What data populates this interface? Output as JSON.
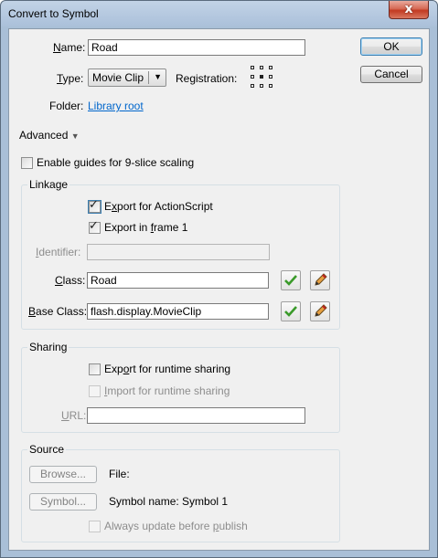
{
  "window": {
    "title": "Convert to Symbol",
    "close_glyph": "x"
  },
  "form": {
    "name_label_u": "N",
    "name_label_rest": "ame:",
    "name_value": "Road",
    "type_label_u": "T",
    "type_label_rest": "ype:",
    "type_value": "Movie Clip",
    "registration_label": "Registration:",
    "folder_label": "Folder:",
    "folder_value": "Library root",
    "advanced_label": "Advanced"
  },
  "buttons": {
    "ok": "OK",
    "cancel": "Cancel"
  },
  "nine_slice": {
    "pre": "Enable ",
    "u": "g",
    "post": "uides for 9-slice scaling",
    "checked": false
  },
  "linkage": {
    "title": "Linkage",
    "export_actionscript": {
      "pre": "E",
      "u": "x",
      "post": "port for ActionScript",
      "checked": true
    },
    "export_frame1": {
      "pre": "Export in ",
      "u": "f",
      "post": "rame 1",
      "checked": true
    },
    "identifier_label_u": "I",
    "identifier_label_rest": "dentifier:",
    "identifier_value": "",
    "class_label_u": "C",
    "class_label_rest": "lass:",
    "class_value": "Road",
    "base_class_label_u": "B",
    "base_class_label_rest": "ase Class:",
    "base_class_value": "flash.display.MovieClip"
  },
  "sharing": {
    "title": "Sharing",
    "export_runtime": {
      "pre": "Exp",
      "u": "o",
      "post": "rt for runtime sharing",
      "checked": false
    },
    "import_runtime": {
      "pre": "",
      "u": "I",
      "post": "mport for runtime sharing",
      "checked": false
    },
    "url_label_u": "U",
    "url_label_rest": "RL:",
    "url_value": ""
  },
  "source": {
    "title": "Source",
    "browse_btn": "Browse...",
    "file_label": "File:",
    "symbol_btn": "Symbol...",
    "symbol_name": "Symbol name: Symbol 1",
    "always_update": {
      "pre": "Always update before ",
      "u": "p",
      "post": "ublish",
      "checked": false
    }
  }
}
